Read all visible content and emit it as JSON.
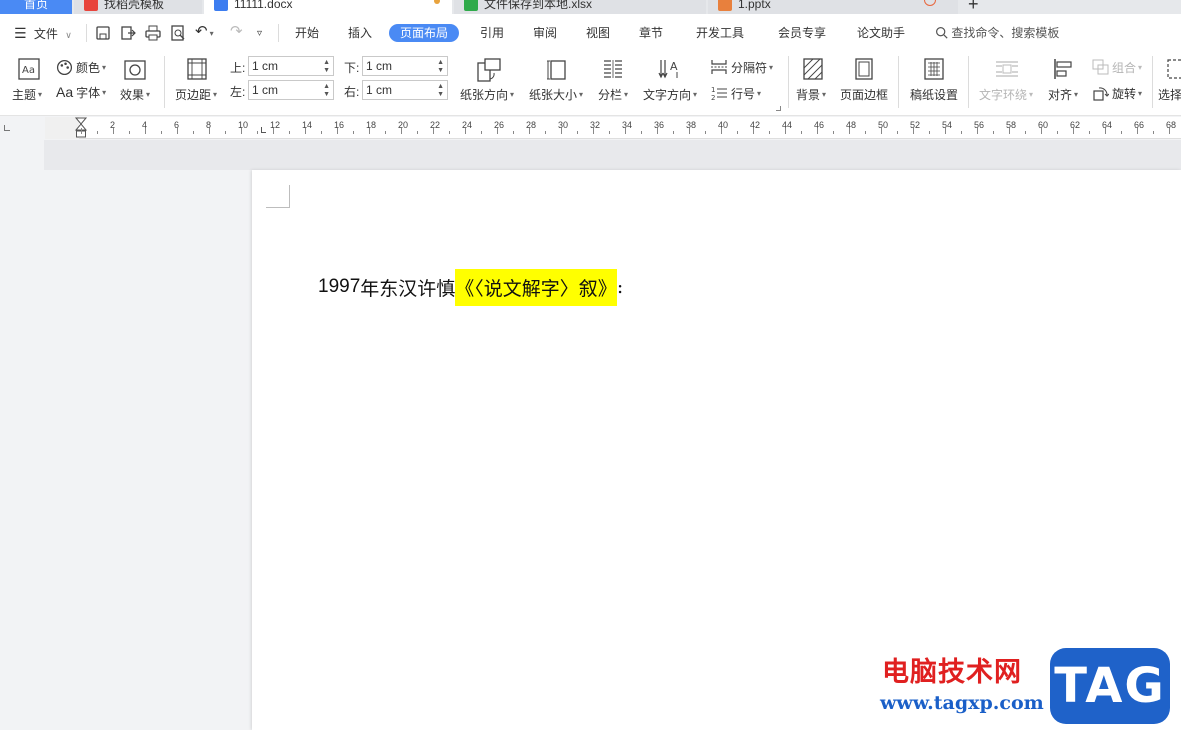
{
  "tabs": [
    {
      "label": "首页"
    },
    {
      "label": "找稻壳模板"
    },
    {
      "label": "11111.docx"
    },
    {
      "label": "文件保存到本地.xlsx"
    },
    {
      "label": "1.pptx"
    }
  ],
  "colors": {
    "accent": "#4a8af4",
    "highlight": "#ffff00",
    "wps_red": "#e8453c",
    "xlsx_green": "#2faa4a",
    "pptx_orange": "#e8803d"
  },
  "menu": {
    "file": "文件",
    "items": [
      "开始",
      "插入",
      "页面布局",
      "引用",
      "审阅",
      "视图",
      "章节",
      "开发工具",
      "会员专享",
      "论文助手"
    ],
    "active": "页面布局",
    "search": "查找命令、搜索模板"
  },
  "ribbon": {
    "theme": "主题",
    "color": "颜色",
    "font": "字体",
    "effect": "效果",
    "margins": "页边距",
    "top_label": "上:",
    "top_value": "1 cm",
    "bottom_label": "下:",
    "bottom_value": "1 cm",
    "left_label": "左:",
    "left_value": "1 cm",
    "right_label": "右:",
    "right_value": "1 cm",
    "orientation": "纸张方向",
    "size": "纸张大小",
    "columns": "分栏",
    "text_direction": "文字方向",
    "breaks": "分隔符",
    "line_numbers": "行号",
    "background": "背景",
    "page_border": "页面边框",
    "manuscript": "稿纸设置",
    "text_wrap": "文字环绕",
    "align": "对齐",
    "group": "组合",
    "rotate": "旋转",
    "select": "选择"
  },
  "ruler": {
    "labels": [
      "2",
      "4",
      "6",
      "8",
      "10",
      "12",
      "14",
      "16",
      "18",
      "20",
      "22",
      "24",
      "26",
      "28",
      "30",
      "32",
      "34",
      "36",
      "38",
      "40",
      "42",
      "44",
      "46",
      "48",
      "50",
      "52",
      "54",
      "56",
      "58",
      "60",
      "62",
      "64",
      "66",
      "68"
    ]
  },
  "document": {
    "year": "1997",
    "before": " 年东汉许慎",
    "highlighted": "《〈说文解字〉叙》",
    "after": ":"
  },
  "watermark": {
    "title": "电脑技术网",
    "url": "www.tagxp.com",
    "tag": "TAG"
  }
}
